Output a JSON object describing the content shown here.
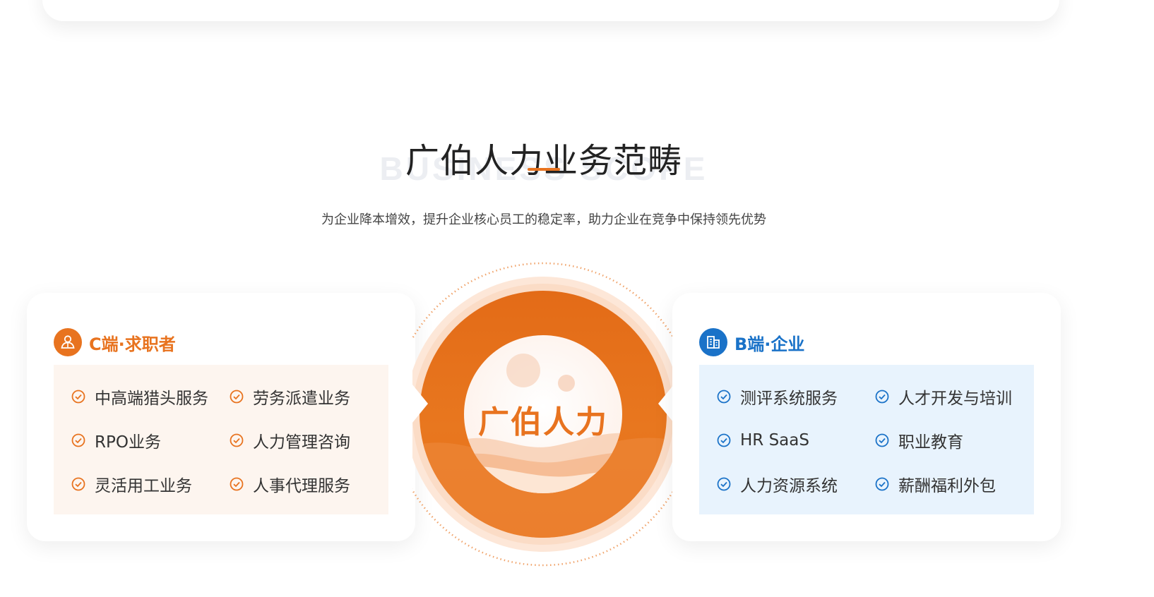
{
  "section": {
    "title": "广伯人力业务范畴",
    "bg_text": "BUSINESS SCOPE",
    "subtitle": "为企业降本增效，提升企业核心员工的稳定率，助力企业在竞争中保持领先优势"
  },
  "center": {
    "label": "广伯人力"
  },
  "c_side": {
    "title": "C端·求职者",
    "icon": "users-icon",
    "accent": "#e8731f",
    "items": [
      "中高端猎头服务",
      "劳务派遣业务",
      "RPO业务",
      "人力管理咨询",
      "灵活用工业务",
      "人事代理服务"
    ]
  },
  "b_side": {
    "title": "B端·企业",
    "icon": "building-icon",
    "accent": "#1a72c8",
    "items": [
      "测评系统服务",
      "人才开发与培训",
      "HR SaaS",
      "职业教育",
      "人力资源系统",
      "薪酬福利外包"
    ]
  }
}
